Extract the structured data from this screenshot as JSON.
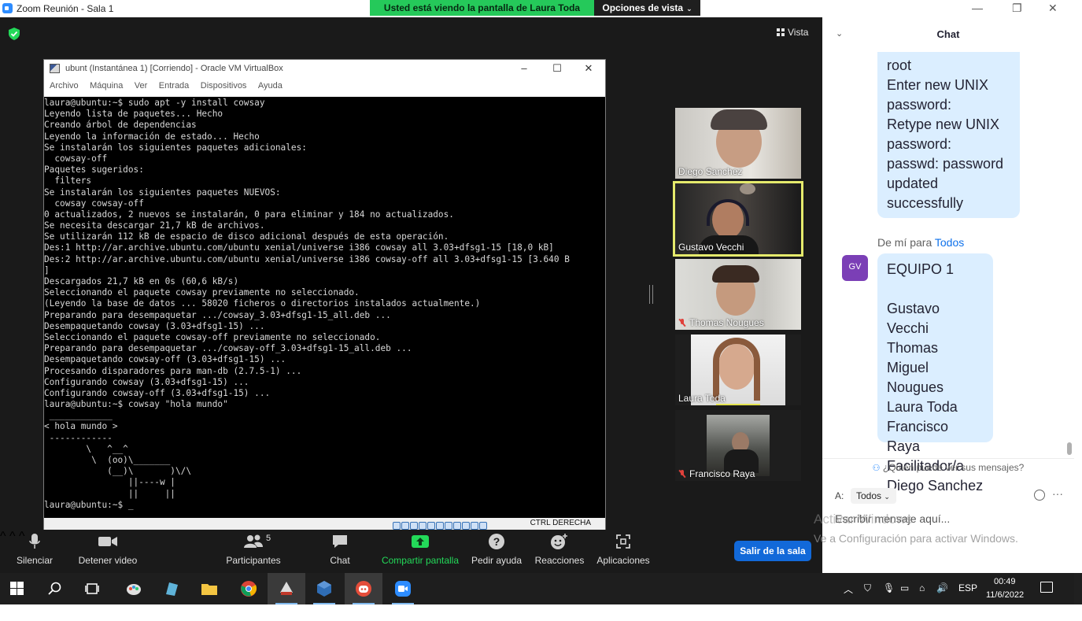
{
  "window": {
    "title": "Zoom Reunión - Sala 1",
    "share_banner": "Usted está viendo la pantalla de Laura Toda",
    "view_options": "Opciones de vista",
    "view_button": "Vista"
  },
  "vbox": {
    "title": "ubunt (Instantánea 1) [Corriendo] - Oracle VM VirtualBox",
    "menu": [
      "Archivo",
      "Máquina",
      "Ver",
      "Entrada",
      "Dispositivos",
      "Ayuda"
    ],
    "host_key": "CTRL DERECHA",
    "terminal_lines": [
      "laura@ubuntu:~$ sudo apt -y install cowsay",
      "Leyendo lista de paquetes... Hecho",
      "Creando árbol de dependencias",
      "Leyendo la información de estado... Hecho",
      "Se instalarán los siguientes paquetes adicionales:",
      "  cowsay-off",
      "Paquetes sugeridos:",
      "  filters",
      "Se instalarán los siguientes paquetes NUEVOS:",
      "  cowsay cowsay-off",
      "0 actualizados, 2 nuevos se instalarán, 0 para eliminar y 184 no actualizados.",
      "Se necesita descargar 21,7 kB de archivos.",
      "Se utilizarán 112 kB de espacio de disco adicional después de esta operación.",
      "Des:1 http://ar.archive.ubuntu.com/ubuntu xenial/universe i386 cowsay all 3.03+dfsg1-15 [18,0 kB]",
      "Des:2 http://ar.archive.ubuntu.com/ubuntu xenial/universe i386 cowsay-off all 3.03+dfsg1-15 [3.640 B",
      "]",
      "Descargados 21,7 kB en 0s (60,6 kB/s)",
      "Seleccionando el paquete cowsay previamente no seleccionado.",
      "(Leyendo la base de datos ... 58020 ficheros o directorios instalados actualmente.)",
      "Preparando para desempaquetar .../cowsay_3.03+dfsg1-15_all.deb ...",
      "Desempaquetando cowsay (3.03+dfsg1-15) ...",
      "Seleccionando el paquete cowsay-off previamente no seleccionado.",
      "Preparando para desempaquetar .../cowsay-off_3.03+dfsg1-15_all.deb ...",
      "Desempaquetando cowsay-off (3.03+dfsg1-15) ...",
      "Procesando disparadores para man-db (2.7.5-1) ...",
      "Configurando cowsay (3.03+dfsg1-15) ...",
      "Configurando cowsay-off (3.03+dfsg1-15) ...",
      "laura@ubuntu:~$ cowsay \"hola mundo\"",
      " ____________",
      "< hola mundo >",
      " ------------",
      "        \\   ^__^",
      "         \\  (oo)\\_______",
      "            (__)\\       )\\/\\",
      "                ||----w |",
      "                ||     ||",
      "laura@ubuntu:~$ _"
    ]
  },
  "participants": [
    {
      "name": "Diego Sanchez",
      "muted": false,
      "active": false
    },
    {
      "name": "Gustavo Vecchi",
      "muted": false,
      "active": true
    },
    {
      "name": "Thomas Nougues",
      "muted": true,
      "active": false
    },
    {
      "name": "Laura Toda",
      "muted": false,
      "active": false
    },
    {
      "name": "Francisco Raya",
      "muted": true,
      "active": false
    }
  ],
  "toolbar": {
    "mute": "Silenciar",
    "video": "Detener video",
    "participants": "Participantes",
    "participants_count": "5",
    "chat": "Chat",
    "share": "Compartir pantalla",
    "help": "Pedir ayuda",
    "reactions": "Reacciones",
    "apps": "Aplicaciones",
    "leave": "Salir de la sala"
  },
  "chat": {
    "title": "Chat",
    "message1_lines": [
      "root",
      "Enter new UNIX",
      "password:",
      "Retype new UNIX",
      "password:",
      "passwd: password",
      "updated",
      "successfully"
    ],
    "from_prefix": "De mí para",
    "from_to": "Todos",
    "avatar_initials": "GV",
    "message2_lines": [
      "EQUIPO 1",
      "",
      "Gustavo Vecchi",
      "Thomas Miguel",
      "Nougues",
      "Laura Toda",
      "Francisco Raya",
      "Facilitador/a",
      "Diego Sanchez"
    ],
    "who_sees": "¿Quién puede ver sus mensajes?",
    "to_label": "A:",
    "to_value": "Todos",
    "input_placeholder": "Escribir mensaje aquí...",
    "watermark1": "Activar Windows",
    "watermark2": "Ve a Configuración para activar Windows."
  },
  "taskbar": {
    "lang": "ESP",
    "time": "00:49",
    "date": "11/6/2022",
    "accent": "#80b9ee"
  },
  "colors": {
    "share_green": "#25c95a",
    "leave_blue": "#1269d9",
    "chat_bubble": "#dbeeff",
    "active_speaker": "#e5ea6c"
  }
}
